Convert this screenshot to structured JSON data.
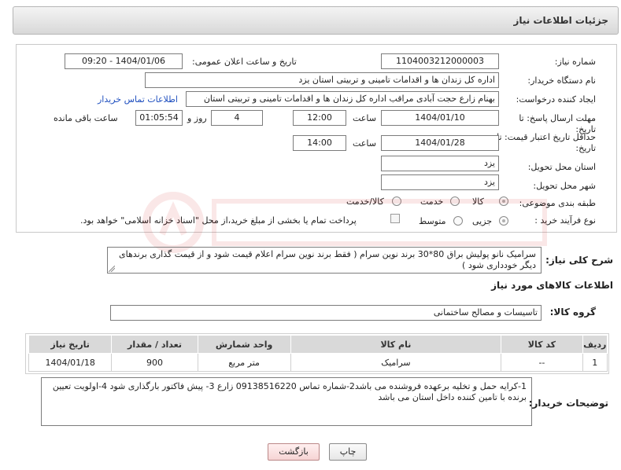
{
  "header": {
    "title": "جزئیات اطلاعات نیاز"
  },
  "fields": {
    "need_number_label": "شماره نیاز:",
    "need_number": "1104003212000003",
    "announce_label": "تاریخ و ساعت اعلان عمومی:",
    "announce_value": "1404/01/06 - 09:20",
    "buyer_label": "نام دستگاه خریدار:",
    "buyer_value": "اداره کل زندان ها و اقدامات تامینی و تربیتی استان یزد",
    "creator_label": "ایجاد کننده درخواست:",
    "creator_value": "بهنام زارع حجت آبادی مراقب اداره کل زندان ها و اقدامات تامینی و تربیتی استان",
    "buyer_contact_link": "اطلاعات تماس خریدار",
    "deadline_label_1": "مهلت ارسال پاسخ: تا",
    "deadline_label_2": "تاریخ:",
    "deadline_date": "1404/01/10",
    "time_label": "ساعت",
    "deadline_time": "12:00",
    "days_value": "4",
    "days_label": "روز و",
    "remaining_value": "01:05:54",
    "remaining_label": "ساعت باقی مانده",
    "validity_label_1": "حداقل تاریخ اعتبار قیمت: تا",
    "validity_label_2": "تاریخ:",
    "validity_date": "1404/01/28",
    "validity_time_label": "ساعت",
    "validity_time": "14:00",
    "province_label": "استان محل تحویل:",
    "province_value": "یزد",
    "city_label": "شهر محل تحویل:",
    "city_value": "یزد",
    "category_label": "طبقه بندی موضوعی:",
    "category_options": [
      "کالا",
      "خدمت",
      "کالا/خدمت"
    ],
    "purchase_label": "نوع فرآیند خرید :",
    "purchase_options": [
      "جزیی",
      "متوسط"
    ],
    "payment_text": "پرداخت تمام یا بخشی از مبلغ خرید،از محل \"اسناد خزانه اسلامی\" خواهد بود."
  },
  "description": {
    "label": "شرح کلی نیاز:",
    "value": "سرامیک نانو پولیش براق 80*30 برند نوین سرام ( فقط برند نوین سرام اعلام قیمت شود و از قیمت گذاری برندهای دیگر خودداری شود )"
  },
  "goods": {
    "section_title": "اطلاعات کالاهای مورد نیاز",
    "group_label": "گروه کالا:",
    "group_value": "تاسیسات و مصالح ساختمانی",
    "columns": [
      "ردیف",
      "کد کالا",
      "نام کالا",
      "واحد شمارش",
      "تعداد / مقدار",
      "تاریخ نیاز"
    ],
    "rows": [
      [
        "1",
        "--",
        "سرامیک",
        "متر مربع",
        "900",
        "1404/01/18"
      ]
    ]
  },
  "buyer_notes": {
    "label": "توضیحات خریدار:",
    "value": "1-کرایه حمل و تخلیه برعهده فروشنده می باشد2-شماره تماس 09138516220 زارع 3- پیش فاکتور بارگذاری شود 4-اولویت تعیین برنده با تامین کننده داخل استان می باشد"
  },
  "buttons": {
    "print": "چاپ",
    "back": "بازگشت"
  },
  "colors": {
    "link": "#1f4fbf",
    "header_bg": "#d8d8d8",
    "table_header_bg": "#d9d9d9"
  }
}
